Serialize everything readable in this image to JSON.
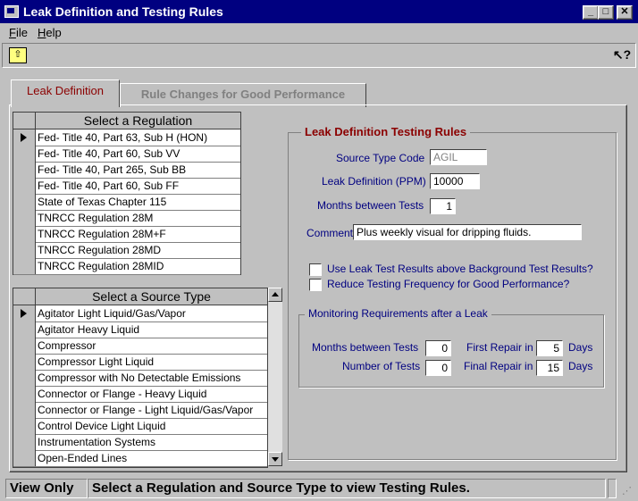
{
  "window": {
    "title": "Leak Definition and Testing Rules"
  },
  "menu": {
    "file": "File",
    "help": "Help"
  },
  "tabs": {
    "leak_definition": "Leak Definition",
    "rule_changes": "Rule Changes for Good Performance"
  },
  "regulation_grid": {
    "header": "Select a Regulation",
    "rows": [
      "Fed- Title 40, Part 63, Sub H (HON)",
      "Fed- Title 40, Part 60, Sub VV",
      "Fed- Title 40, Part 265, Sub BB",
      "Fed- Title 40, Part 60, Sub FF",
      "State of Texas Chapter 115",
      "TNRCC Regulation 28M",
      "TNRCC Regulation 28M+F",
      "TNRCC Regulation 28MD",
      "TNRCC Regulation 28MID"
    ]
  },
  "source_grid": {
    "header": "Select a Source Type",
    "rows": [
      "Agitator Light Liquid/Gas/Vapor",
      "Agitator Heavy Liquid",
      "Compressor",
      "Compressor Light Liquid",
      "Compressor with No Detectable Emissions",
      "Connector or Flange - Heavy Liquid",
      "Connector or Flange - Light Liquid/Gas/Vapor",
      "Control Device Light Liquid",
      "Instrumentation Systems",
      "Open-Ended Lines"
    ]
  },
  "testing_rules": {
    "title": "Leak Definition Testing Rules",
    "source_type_code_label": "Source Type Code",
    "source_type_code_value": "AGIL",
    "leak_definition_label": "Leak Definition (PPM)",
    "leak_definition_value": "10000",
    "months_between_tests_label": "Months between Tests",
    "months_between_tests_value": "1",
    "comment_label": "Comment",
    "comment_value": "Plus weekly visual for dripping fluids.",
    "check_background": "Use Leak Test Results above Background Test Results?",
    "check_reduce": "Reduce Testing Frequency for Good Performance?"
  },
  "monitoring": {
    "title": "Monitoring Requirements after a Leak",
    "months_between_tests_label": "Months between Tests",
    "months_between_tests_value": "0",
    "number_of_tests_label": "Number of Tests",
    "number_of_tests_value": "0",
    "first_repair_label": "First Repair in",
    "first_repair_value": "5",
    "final_repair_label": "Final Repair in",
    "final_repair_value": "15",
    "days_label": "Days"
  },
  "status": {
    "mode": "View Only",
    "message": "Select a Regulation and Source Type to view Testing Rules."
  },
  "colors": {
    "titlebar": "#000080",
    "face": "#c0c0c0",
    "label_navy": "#000080",
    "group_title": "#8b0000"
  }
}
